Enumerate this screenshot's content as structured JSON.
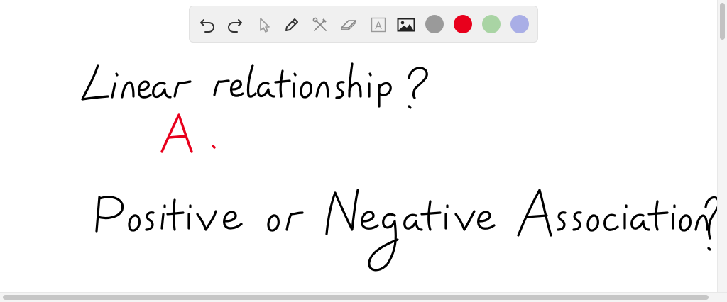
{
  "toolbar": {
    "tools": [
      {
        "id": "undo",
        "icon": "undo-icon"
      },
      {
        "id": "redo",
        "icon": "redo-icon"
      },
      {
        "id": "select",
        "icon": "pointer-icon"
      },
      {
        "id": "pen",
        "icon": "pen-icon"
      },
      {
        "id": "tools",
        "icon": "tools-icon"
      },
      {
        "id": "eraser",
        "icon": "eraser-icon"
      },
      {
        "id": "text",
        "icon": "text-icon",
        "glyph": "A"
      },
      {
        "id": "image",
        "icon": "image-icon"
      }
    ],
    "colors": [
      "#9a9a9a",
      "#e8001c",
      "#a9d4a4",
      "#a9aee6"
    ]
  },
  "ink": {
    "line1": "Linear relationship?",
    "answer": "A.",
    "line2": "Positive or Negative Association?",
    "ink_color": "#000000",
    "answer_color": "#e8001c"
  }
}
